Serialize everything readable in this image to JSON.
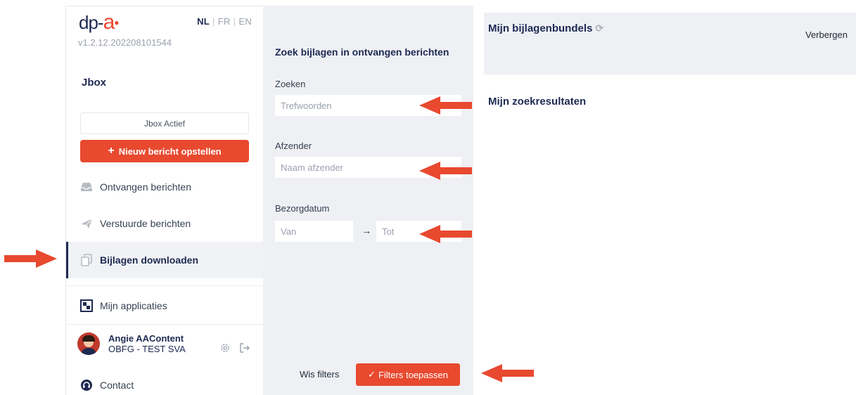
{
  "colors": {
    "accent": "#e8492f",
    "navy": "#1e2a52",
    "panel": "#eef0f4"
  },
  "sidebar": {
    "logo": {
      "prefix": "dp-",
      "letter": "a"
    },
    "version": "v1.2.12.202208101544",
    "languages": [
      "NL",
      "FR",
      "EN"
    ],
    "active_language": "NL",
    "app_title": "Jbox",
    "status": "Jbox Actief",
    "new_message_button": "Nieuw bericht opstellen",
    "nav": [
      {
        "label": "Ontvangen berichten",
        "icon": "inbox-icon"
      },
      {
        "label": "Verstuurde berichten",
        "icon": "paper-plane-icon"
      },
      {
        "label": "Bijlagen downloaden",
        "icon": "copy-documents-icon",
        "active": true
      },
      {
        "label": "Mijn applicaties",
        "icon": "apps-grid-icon"
      }
    ],
    "user": {
      "name": "Angie AAContent",
      "org": "OBFG - TEST SVA"
    },
    "contact": "Contact"
  },
  "filters": {
    "title": "Zoek bijlagen in ontvangen berichten",
    "search": {
      "label": "Zoeken",
      "placeholder": "Trefwoorden"
    },
    "sender": {
      "label": "Afzender",
      "placeholder": "Naam afzender"
    },
    "date": {
      "label": "Bezorgdatum",
      "from_placeholder": "Van",
      "to_placeholder": "Tot"
    },
    "clear_button": "Wis filters",
    "apply_button": "Filters toepassen"
  },
  "main": {
    "bundles_title": "Mijn bijlagenbundels",
    "hide_link": "Verbergen",
    "results_title": "Mijn zoekresultaten"
  }
}
